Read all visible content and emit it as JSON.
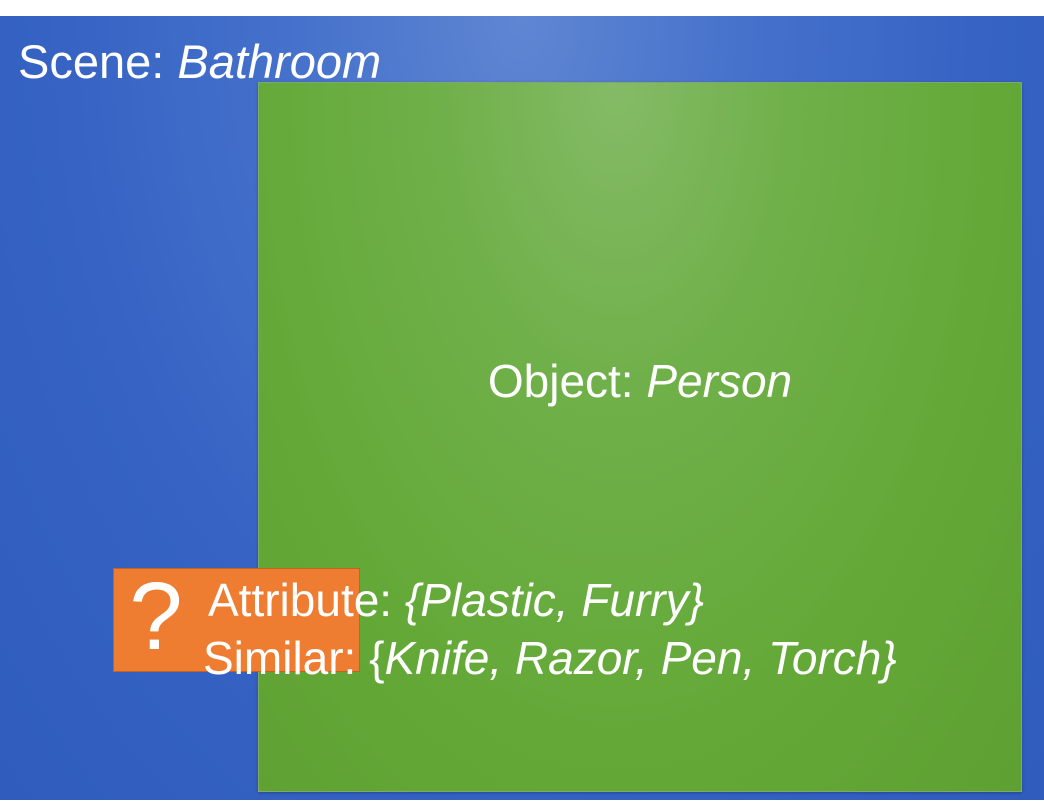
{
  "scene": {
    "prefix": "Scene: ",
    "value": "Bathroom"
  },
  "object": {
    "prefix": "Object: ",
    "value": "Person"
  },
  "unknown": {
    "mark": "?",
    "attribute_prefix": "Attribute: ",
    "attribute_value": "{Plastic, Furry}",
    "similar_prefix": "Similar: {",
    "similar_value": "Knife, Razor, Pen, Torch}"
  },
  "colors": {
    "scene_box": "#3562c3",
    "object_box": "#64a938",
    "unknown_box": "#ef7d31",
    "text": "#ffffff"
  }
}
